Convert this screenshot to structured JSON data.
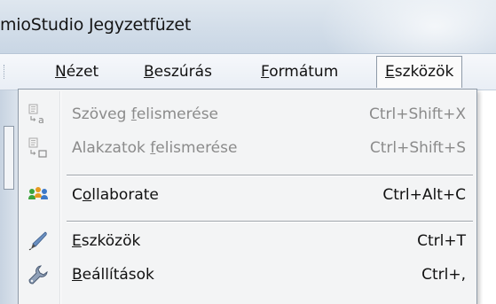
{
  "window": {
    "title": "mioStudio Jegyzetfüzet"
  },
  "menubar": {
    "items": [
      {
        "accel": "N",
        "rest": "ézet"
      },
      {
        "accel": "B",
        "rest": "eszúrás"
      },
      {
        "accel": "F",
        "rest": "ormátum"
      },
      {
        "accel": "E",
        "rest": "szközök",
        "active": true
      }
    ]
  },
  "dropdown": {
    "items": [
      {
        "pre": "Szöveg ",
        "accel": "f",
        "post": "elismerése",
        "shortcut": "Ctrl+Shift+X",
        "enabled": false,
        "icon": "text-recognition-icon"
      },
      {
        "pre": "Alakzatok ",
        "accel": "f",
        "post": "elismerése",
        "shortcut": "Ctrl+Shift+S",
        "enabled": false,
        "icon": "shape-recognition-icon"
      },
      {
        "pre": "C",
        "accel": "o",
        "post": "llaborate",
        "shortcut": "Ctrl+Alt+C",
        "enabled": true,
        "icon": "collaborate-people-icon"
      },
      {
        "pre": "",
        "accel": "E",
        "post": "szközök",
        "shortcut": "Ctrl+T",
        "enabled": true,
        "icon": "pen-icon"
      },
      {
        "pre": "",
        "accel": "B",
        "post": "eállítások",
        "shortcut": "Ctrl+,",
        "enabled": true,
        "icon": "wrench-icon"
      }
    ]
  },
  "colors": {
    "disabled_text": "#8b8b8b",
    "menu_background": "#f3f4f5",
    "people_green": "#3da33d",
    "people_orange": "#e69a1f",
    "people_blue": "#3b78c8"
  }
}
